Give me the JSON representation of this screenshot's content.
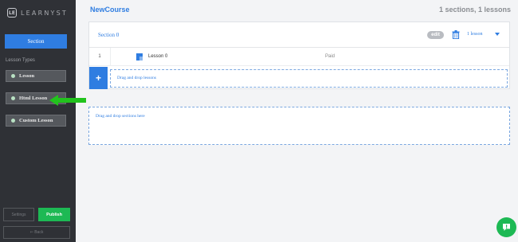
{
  "brand": {
    "mark": "LE",
    "name": "LEARNYST"
  },
  "sidebar": {
    "section_button": "Section",
    "lesson_types_label": "Lesson Types",
    "lesson_types": [
      {
        "label": "Lesson"
      },
      {
        "label": "Html Lesson"
      },
      {
        "label": "Custom Lesson"
      }
    ],
    "settings_label": "Settings",
    "publish_label": "Publish",
    "back_label": "⇐ Back"
  },
  "course": {
    "title": "NewCourse",
    "summary": "1 sections, 1 lessons"
  },
  "section": {
    "name": "Section 0",
    "edit_label": "edit",
    "lesson_count": "1 lesson",
    "lessons": [
      {
        "index": "1",
        "name": "Lesson 0",
        "price": "Paid"
      }
    ],
    "add_label": "+",
    "drop_lessons": "Drag and drop lessons"
  },
  "drop_sections": "Drag and drop sections here",
  "icons": {
    "brand": "logo-icon",
    "lesson_dot": "dot-icon",
    "arrow": "arrow-left-icon",
    "trash": "trash-icon",
    "dropdown": "chevron-down-icon",
    "lesson": "file-icon",
    "chat": "chat-icon"
  },
  "colors": {
    "accent": "#2f7de1",
    "sidebar_bg": "#2f3136",
    "publish": "#1db954",
    "arrow": "#22c31d"
  }
}
